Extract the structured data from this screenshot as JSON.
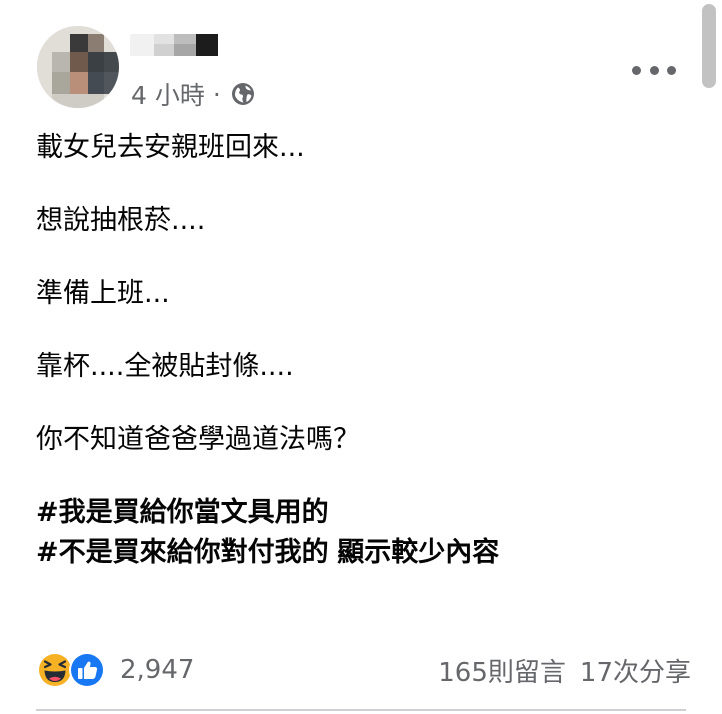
{
  "post": {
    "time_label": "4 小時",
    "separator": "·",
    "privacy_icon": "globe-icon",
    "more_icon": "more-options-icon"
  },
  "content": {
    "lines": [
      "載女兒去安親班回來...",
      "想說抽根菸....",
      "準備上班...",
      "靠杯....全被貼封條....",
      "你不知道爸爸學過道法嗎？"
    ],
    "hashtag_1": "#我是買給你當文具用的",
    "hashtag_2": "#不是買來給你對付我的",
    "see_more": "顯示較少內容"
  },
  "stats": {
    "reaction_icons": [
      "haha-icon",
      "like-icon"
    ],
    "reaction_count": "2,947",
    "comments": "165則留言",
    "shares": "17次分享"
  },
  "colors": {
    "text": "#050505",
    "secondary": "#65676b",
    "like_blue": "#1877f2",
    "haha_yellow": "#f7b125",
    "divider": "#ced0d4"
  }
}
